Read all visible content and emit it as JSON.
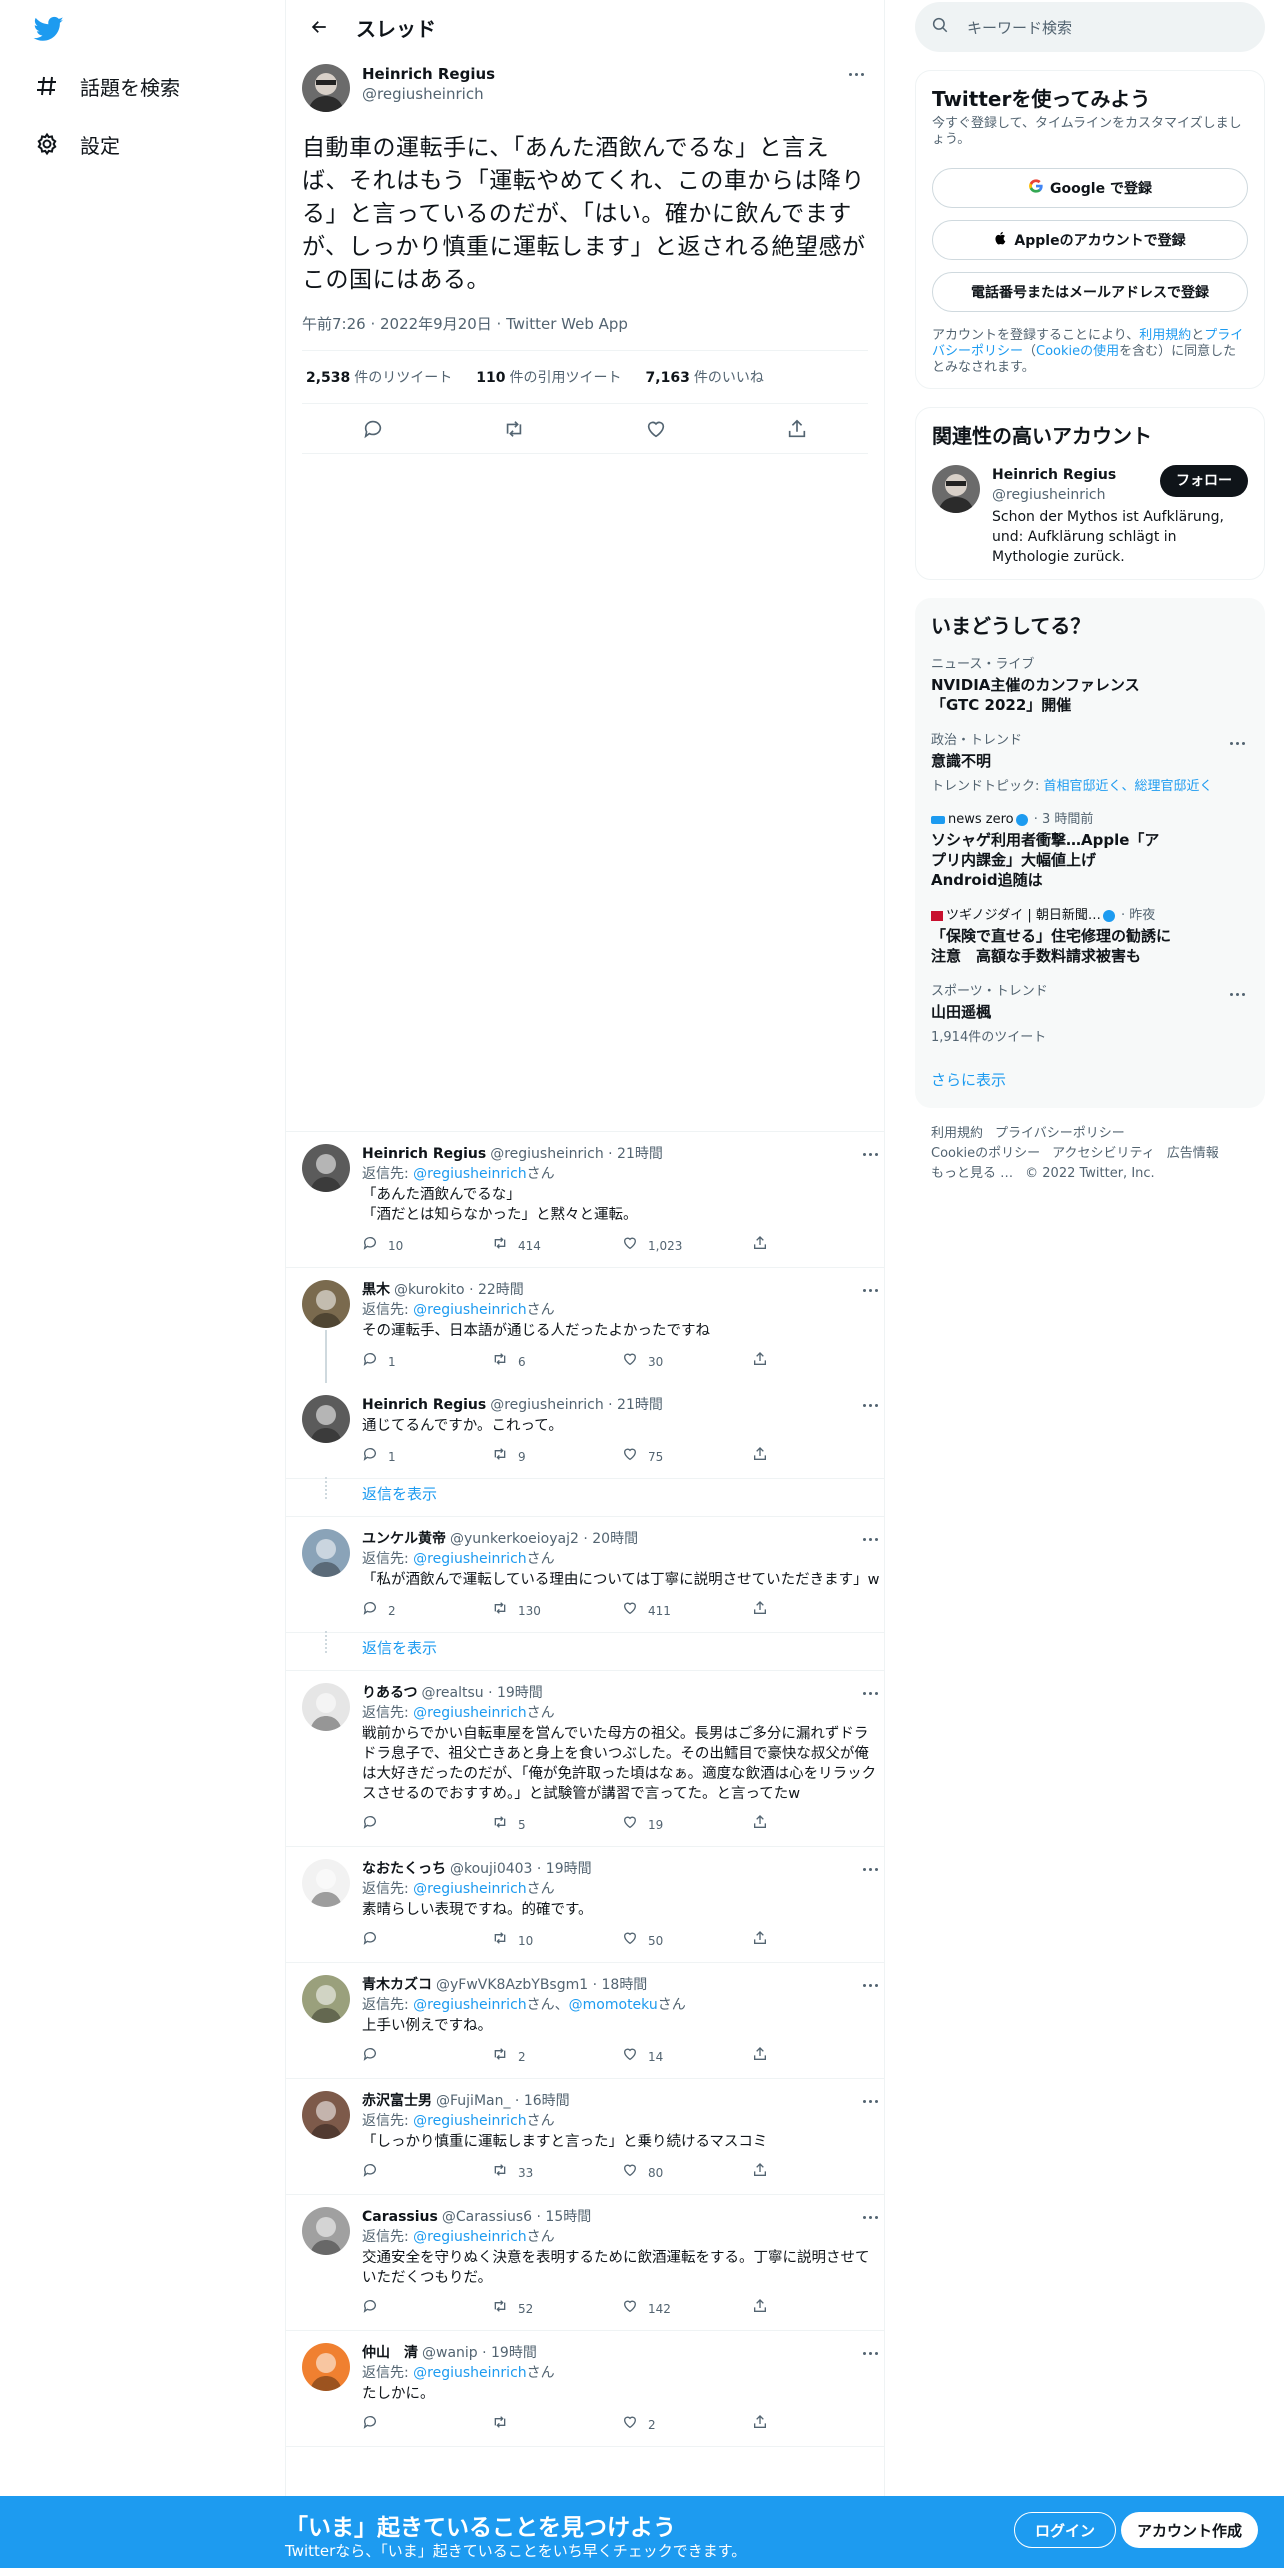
{
  "nav": {
    "explore": "話題を検索",
    "settings": "設定"
  },
  "header": {
    "title": "スレッド"
  },
  "focal": {
    "name": "Heinrich Regius",
    "handle": "@regiusheinrich",
    "text": "自動車の運転手に、「あんた酒飲んでるな」と言えば、それはもう「運転やめてくれ、この車からは降りる」と言っているのだが、「はい。確かに飲んでますが、しっかり慎重に運転します」と返される絶望感がこの国にはある。",
    "time": "午前7:26 · 2022年9月20日 · Twitter Web App",
    "retweets": "2,538",
    "retweets_label": "件のリツイート",
    "quotes": "110",
    "quotes_label": "件の引用ツイート",
    "likes": "7,163",
    "likes_label": "件のいいね"
  },
  "replies": [
    {
      "name": "Heinrich Regius",
      "meta": "@regiusheinrich · 21時間",
      "replyto_prefix": "返信先: ",
      "replyto": "@regiusheinrich",
      "replyto_suffix": "さん",
      "text": "「あんた酒飲んでるな」\n「酒だとは知らなかった」と黙々と運転。",
      "c": "10",
      "r": "414",
      "l": "1,023"
    },
    {
      "name": "黒木",
      "meta": "@kurokito · 22時間",
      "replyto_prefix": "返信先: ",
      "replyto": "@regiusheinrich",
      "replyto_suffix": "さん",
      "text": "その運転手、日本語が通じる人だったよかったですね",
      "c": "1",
      "r": "6",
      "l": "30"
    },
    {
      "name": "Heinrich Regius",
      "meta": "@regiusheinrich · 21時間",
      "text": "通じてるんですか。これって。",
      "c": "1",
      "r": "9",
      "l": "75"
    },
    {
      "name": "ユンケル黄帝",
      "meta": "@yunkerkoeioyaj2 · 20時間",
      "replyto_prefix": "返信先: ",
      "replyto": "@regiusheinrich",
      "replyto_suffix": "さん",
      "text": "「私が酒飲んで運転している理由については丁寧に説明させていただきます」w",
      "c": "2",
      "r": "130",
      "l": "411"
    },
    {
      "name": "りあるつ",
      "meta": "@realtsu · 19時間",
      "replyto_prefix": "返信先: ",
      "replyto": "@regiusheinrich",
      "replyto_suffix": "さん",
      "text": "戦前からでかい自転車屋を営んでいた母方の祖父。長男はご多分に漏れずドラドラ息子で、祖父亡きあと身上を食いつぶした。その出鱈目で豪快な叔父が俺は大好きだったのだが、「俺が免許取った頃はなぁ。適度な飲酒は心をリラックスさせるのでおすすめ。」と試験管が講習で言ってた。と言ってたw",
      "c": "",
      "r": "5",
      "l": "19"
    },
    {
      "name": "なおたくっち",
      "meta": "@kouji0403 · 19時間",
      "replyto_prefix": "返信先: ",
      "replyto": "@regiusheinrich",
      "replyto_suffix": "さん",
      "text": "素晴らしい表現ですね。的確です。",
      "c": "",
      "r": "10",
      "l": "50"
    },
    {
      "name": "青木カズコ",
      "meta": "@yFwVK8AzbYBsgm1 · 18時間",
      "replyto_prefix": "返信先: ",
      "replyto": "@regiusheinrich",
      "replyto_mid": "さん、",
      "replyto2": "@momoteku",
      "replyto_suffix": "さん",
      "text": "上手い例えですね。",
      "c": "",
      "r": "2",
      "l": "14"
    },
    {
      "name": "赤沢富士男",
      "meta": "@FujiMan_ · 16時間",
      "replyto_prefix": "返信先: ",
      "replyto": "@regiusheinrich",
      "replyto_suffix": "さん",
      "text": "「しっかり慎重に運転しますと言った」と乗り続けるマスコミ",
      "c": "",
      "r": "33",
      "l": "80"
    },
    {
      "name": "Carassius",
      "meta": "@Carassius6 · 15時間",
      "replyto_prefix": "返信先: ",
      "replyto": "@regiusheinrich",
      "replyto_suffix": "さん",
      "text": "交通安全を守りぬく決意を表明するために飲酒運転をする。丁寧に説明させていただくつもりだ。",
      "c": "",
      "r": "52",
      "l": "142"
    },
    {
      "name": "仲山　清",
      "meta": "@wanip · 19時間",
      "replyto_prefix": "返信先: ",
      "replyto": "@regiusheinrich",
      "replyto_suffix": "さん",
      "text": "たしかに。",
      "c": "",
      "r": "",
      "l": "2"
    }
  ],
  "show_replies": "返信を表示",
  "search": {
    "placeholder": "キーワード検索"
  },
  "signup": {
    "title": "Twitterを使ってみよう",
    "sub": "今すぐ登録して、タイムラインをカスタマイズしましょう。",
    "google": "Google で登録",
    "apple": "Appleのアカウントで登録",
    "phone": "電話番号またはメールアドレスで登録",
    "legal_prefix": "アカウントを登録することにより、",
    "legal_link1": "利用規約",
    "legal_mid": "と",
    "legal_link2": "プライバシーポリシー",
    "legal_paren_open": "（",
    "legal_link3": "Cookieの使用",
    "legal_suffix": "を含む）に同意したとみなされます。"
  },
  "relevant": {
    "title": "関連性の高いアカウント",
    "name": "Heinrich Regius",
    "handle": "@regiusheinrich",
    "follow": "フォロー",
    "bio": "Schon der Mythos ist Aufklärung, und: Aufklärung schlägt in Mythologie zurück."
  },
  "trends": {
    "title": "いまどうしてる？",
    "items": [
      {
        "meta": "ニュース・ライブ",
        "title": "NVIDIA主催のカンファレンス「GTC 2022」開催"
      },
      {
        "meta": "政治・トレンド",
        "title": "意識不明",
        "topic_prefix": "トレンドトピック: ",
        "topic": "首相官邸近く、総理官邸近く"
      },
      {
        "meta": "news zero",
        "meta2": " · 3 時間前",
        "title": "ソシャゲ利用者衝撃…Apple「アプリ内課金」大幅値上げ　Android追随は"
      },
      {
        "meta": "ツギノジダイ | 朝日新聞…",
        "meta2": " · 昨夜",
        "title": "「保険で直せる」住宅修理の勧誘に注意　高額な手数料請求被害も"
      },
      {
        "meta": "スポーツ・トレンド",
        "title": "山田遥楓",
        "count": "1,914件のツイート"
      }
    ],
    "show_more": "さらに表示"
  },
  "footer": {
    "links": [
      "利用規約",
      "プライバシーポリシー",
      "Cookieのポリシー",
      "アクセシビリティ",
      "広告情報",
      "もっと見る …"
    ],
    "copyright": "© 2022 Twitter, Inc."
  },
  "bottom": {
    "title": "「いま」起きていることを見つけよう",
    "sub": "Twitterなら、「いま」起きていることをいち早くチェックできます。",
    "login": "ログイン",
    "signup": "アカウント作成"
  },
  "colors": {
    "brand": "#1d9bf0",
    "text": "#0f1419",
    "muted": "#536471"
  }
}
